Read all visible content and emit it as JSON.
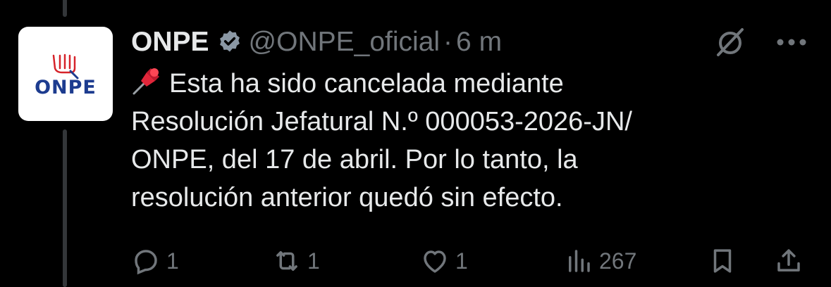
{
  "tweet": {
    "author_name": "ONPE",
    "handle": "@ONPE_oficial",
    "separator": "·",
    "time": "6 m",
    "avatar_text": "ONPE",
    "icons": {
      "verified": "verified-badge-icon",
      "grok": "grok-icon",
      "more": "more-options-icon",
      "pin": "pushpin-emoji"
    },
    "text": "Esta ha sido cancelada mediante\nResolución Jefatural N.º 000053-2026-JN/\nONPE, del 17 de abril. Por lo tanto,  la\nresolución anterior quedó sin efecto."
  },
  "actions": {
    "replies": "1",
    "reposts": "1",
    "likes": "1",
    "views": "267"
  },
  "colors": {
    "background": "#000000",
    "text": "#e7e9ea",
    "muted": "#71767b",
    "onpe_blue": "#1d3c8f",
    "onpe_red": "#d6232a"
  }
}
